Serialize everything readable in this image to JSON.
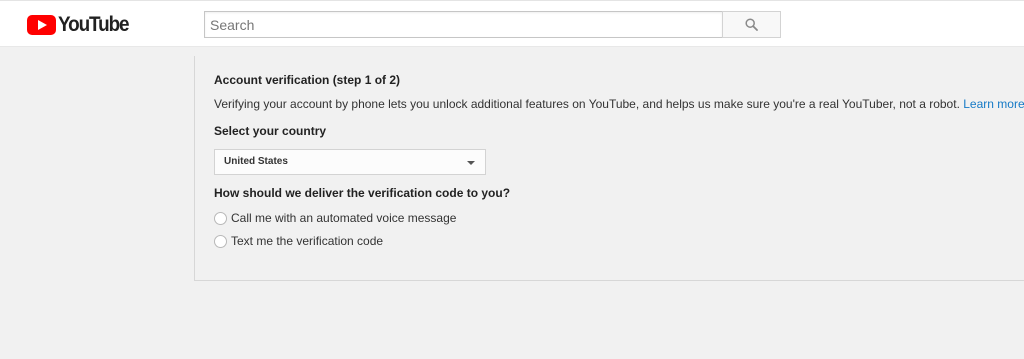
{
  "header": {
    "logo_text": "YouTube",
    "search_placeholder": "Search",
    "search_value": ""
  },
  "verification": {
    "title": "Account verification (step 1 of 2)",
    "description": "Verifying your account by phone lets you unlock additional features on YouTube, and helps us make sure you're a real YouTuber, not a robot.",
    "learn_more": "Learn more",
    "country_label": "Select your country",
    "country_selected": "United States",
    "delivery_question": "How should we deliver the verification code to you?",
    "options": [
      {
        "label": "Call me with an automated voice message",
        "checked": false
      },
      {
        "label": "Text me the verification code",
        "checked": false
      }
    ]
  },
  "colors": {
    "brand_red": "#ff0000",
    "link_blue": "#167ac6",
    "page_bg": "#f1f1f1"
  },
  "icons": {
    "logo": "youtube-play-icon",
    "search": "search-icon",
    "dropdown": "chevron-down-icon"
  }
}
